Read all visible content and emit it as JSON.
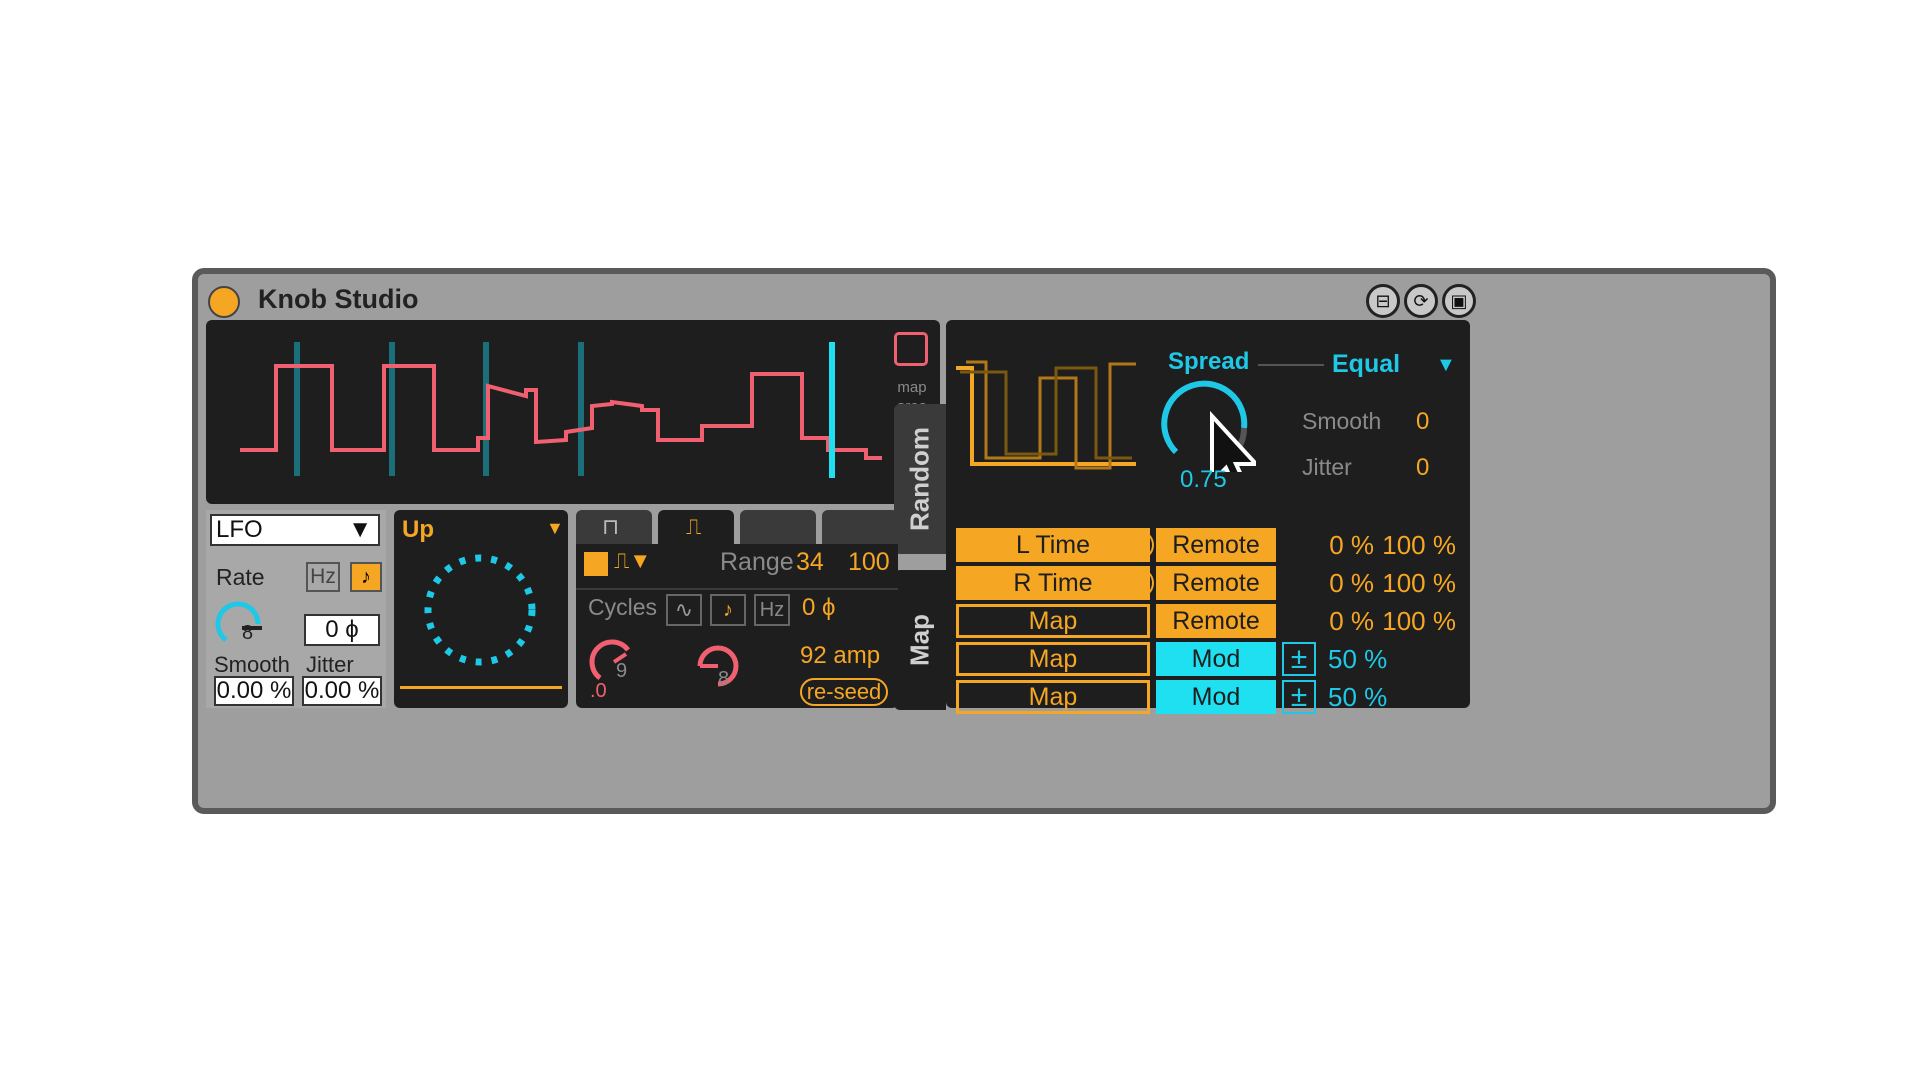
{
  "window": {
    "title": "Knob Studio",
    "buttons": [
      "fold-icon",
      "refresh-icon",
      "save-icon"
    ]
  },
  "map_area": {
    "label_line1": "map",
    "label_line2": "area"
  },
  "side_tabs": {
    "random": "Random",
    "map": "Map"
  },
  "lfo": {
    "mode": "LFO",
    "rate_label": "Rate",
    "hz_label": "Hz",
    "sync_icon": "note-icon",
    "rate_value": "8",
    "phase": "0 ϕ",
    "smooth_label": "Smooth",
    "jitter_label": "Jitter",
    "smooth_value": "0.00 %",
    "jitter_value": "0.00 %"
  },
  "direction": {
    "label": "Up"
  },
  "shape": {
    "range_label": "Range",
    "range_min": "34",
    "range_max": "100",
    "cycles_label": "Cycles",
    "hz_label": "Hz",
    "phase": "0 ϕ",
    "knob1_value": "9",
    "knob1_sub": ".0",
    "knob2_value": "8",
    "amp": "92 amp",
    "reseed": "re-seed"
  },
  "spread": {
    "label": "Spread",
    "mode": "Equal",
    "value": "0.75",
    "level": 0.75,
    "smooth_label": "Smooth",
    "smooth_value": "0",
    "jitter_label": "Jitter",
    "jitter_value": "0"
  },
  "mappings": [
    {
      "target": "L Time",
      "filled": true,
      "has_x": true,
      "source": "Remote",
      "source_kind": "remote",
      "min": "0 %",
      "max": "100 %"
    },
    {
      "target": "R Time",
      "filled": true,
      "has_x": true,
      "source": "Remote",
      "source_kind": "remote",
      "min": "0 %",
      "max": "100 %"
    },
    {
      "target": "Map",
      "filled": false,
      "has_x": false,
      "source": "Remote",
      "source_kind": "remote",
      "min": "0 %",
      "max": "100 %"
    },
    {
      "target": "Map",
      "filled": false,
      "has_x": false,
      "source": "Mod",
      "source_kind": "mod",
      "amount": "50 %"
    },
    {
      "target": "Map",
      "filled": false,
      "has_x": false,
      "source": "Mod",
      "source_kind": "mod",
      "amount": "50 %"
    }
  ],
  "colors": {
    "orange": "#f5a623",
    "cyan": "#1ec8e6",
    "pink": "#f06070",
    "panel": "#1e1e1e"
  }
}
